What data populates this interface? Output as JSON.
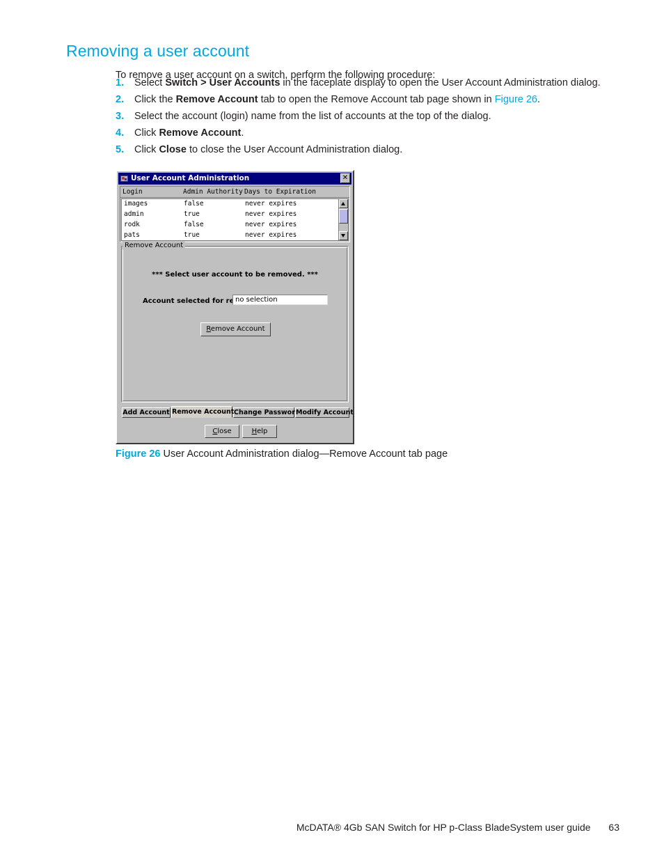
{
  "page": {
    "heading": "Removing a user account",
    "intro": "To remove a user account on a switch, perform the following procedure:",
    "steps": [
      {
        "num": "1.",
        "segments": [
          {
            "t": "Select ",
            "style": "normal"
          },
          {
            "t": "Switch > User Accounts",
            "style": "bold"
          },
          {
            "t": " in the faceplate display to open the User Account Administration dialog.",
            "style": "normal"
          }
        ]
      },
      {
        "num": "2.",
        "segments": [
          {
            "t": "Click the ",
            "style": "normal"
          },
          {
            "t": "Remove Account",
            "style": "bold"
          },
          {
            "t": " tab to open the Remove Account tab page shown in ",
            "style": "normal"
          },
          {
            "t": "Figure 26",
            "style": "xref"
          },
          {
            "t": ".",
            "style": "normal"
          }
        ]
      },
      {
        "num": "3.",
        "segments": [
          {
            "t": "Select the account (login) name from the list of accounts at the top of the dialog.",
            "style": "normal"
          }
        ]
      },
      {
        "num": "4.",
        "segments": [
          {
            "t": "Click ",
            "style": "normal"
          },
          {
            "t": "Remove Account",
            "style": "bold"
          },
          {
            "t": ".",
            "style": "normal"
          }
        ]
      },
      {
        "num": "5.",
        "segments": [
          {
            "t": "Click ",
            "style": "normal"
          },
          {
            "t": "Close",
            "style": "bold"
          },
          {
            "t": " to close the User Account Administration dialog.",
            "style": "normal"
          }
        ]
      }
    ]
  },
  "figure": {
    "label": "Figure 26",
    "text": "User Account Administration dialog—Remove Account tab page"
  },
  "footer": {
    "text": "McDATA® 4Gb SAN Switch for HP p-Class BladeSystem user guide",
    "page_number": "63"
  },
  "dialog": {
    "title": "User Account Administration",
    "close_label": "✕",
    "title_icon": "app-window-icon",
    "accounts_table": {
      "columns": [
        "Login",
        "Admin Authority",
        "Days to Expiration"
      ],
      "rows": [
        {
          "login": "images",
          "admin_authority": "false",
          "days_to_expiration": "never expires"
        },
        {
          "login": "admin",
          "admin_authority": "true",
          "days_to_expiration": "never expires"
        },
        {
          "login": "rodk",
          "admin_authority": "false",
          "days_to_expiration": "never expires"
        },
        {
          "login": "pats",
          "admin_authority": "true",
          "days_to_expiration": "never expires"
        }
      ]
    },
    "group": {
      "title": "Remove Account",
      "message": "*** Select user account to be removed. ***",
      "field_label": "Account selected for removal:",
      "field_value": "no selection",
      "remove_button": "Remove Account"
    },
    "tabs": [
      {
        "label": "Add Account",
        "active": false
      },
      {
        "label": "Remove Account",
        "active": true
      },
      {
        "label": "Change Password",
        "active": false
      },
      {
        "label": "Modify Account",
        "active": false
      }
    ],
    "buttons": {
      "close": "Close",
      "help": "Help"
    },
    "colors": {
      "titlebar": "#00007b",
      "face": "#c0c0c0",
      "scrollbar_thumb": "#b8b8e8"
    }
  },
  "theme": {
    "accent": "#00a8e1",
    "text": "#231f20"
  }
}
